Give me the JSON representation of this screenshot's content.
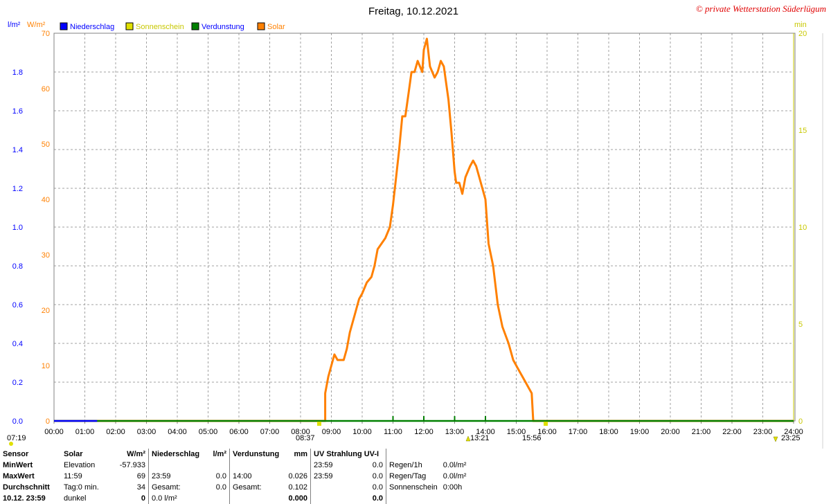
{
  "title": "Freitag, 10.12.2021",
  "copyright": "© private Wetterstation Süderlügum",
  "axis_units": {
    "left_rain": "l/m²",
    "left_solar": "W/m²",
    "right": "min"
  },
  "legend": [
    {
      "label": "Niederschlag",
      "color": "#0000ff",
      "text_color": "#0000ff"
    },
    {
      "label": "Sonnenschein",
      "color": "#e0e000",
      "text_color": "#c8c800"
    },
    {
      "label": "Verdunstung",
      "color": "#008000",
      "text_color": "#0000ff"
    },
    {
      "label": "Solar",
      "color": "#ff8000",
      "text_color": "#ff8000"
    }
  ],
  "markers": {
    "left": "07:19",
    "sunrise": "08:37",
    "noon": "13:21",
    "sunset": "15:56",
    "right": "23:25"
  },
  "right_edge_char": "9",
  "chart_data": {
    "type": "line",
    "title": "Freitag, 10.12.2021",
    "x_ticks": [
      "00:00",
      "01:00",
      "02:00",
      "03:00",
      "04:00",
      "05:00",
      "06:00",
      "07:00",
      "08:00",
      "09:00",
      "10:00",
      "11:00",
      "12:00",
      "13:00",
      "14:00",
      "15:00",
      "16:00",
      "17:00",
      "18:00",
      "19:00",
      "20:00",
      "21:00",
      "22:00",
      "23:00",
      "24:00"
    ],
    "x_range_hours": [
      0,
      24
    ],
    "y_left_rain": {
      "label": "l/m²",
      "range": [
        0,
        2.0
      ],
      "ticks": [
        "0.0",
        "0.2",
        "0.4",
        "0.6",
        "0.8",
        "1.0",
        "1.2",
        "1.4",
        "1.6",
        "1.8"
      ]
    },
    "y_left_solar": {
      "label": "W/m²",
      "range": [
        0,
        70
      ],
      "ticks": [
        "0",
        "10",
        "20",
        "30",
        "40",
        "50",
        "60",
        "70"
      ]
    },
    "y_right": {
      "label": "min",
      "range": [
        0,
        20
      ],
      "ticks": [
        "0",
        "5",
        "10",
        "15",
        "20"
      ]
    },
    "grid": true,
    "series": [
      {
        "name": "Solar",
        "axis": "solar",
        "color": "#ff8000",
        "points": [
          [
            0,
            0
          ],
          [
            8.8,
            0
          ],
          [
            8.8,
            5
          ],
          [
            8.9,
            8
          ],
          [
            9.0,
            10
          ],
          [
            9.1,
            12
          ],
          [
            9.2,
            11
          ],
          [
            9.4,
            11
          ],
          [
            9.5,
            13
          ],
          [
            9.6,
            16
          ],
          [
            9.75,
            19
          ],
          [
            9.9,
            22
          ],
          [
            10.0,
            23
          ],
          [
            10.15,
            25
          ],
          [
            10.3,
            26
          ],
          [
            10.4,
            28
          ],
          [
            10.5,
            31
          ],
          [
            10.75,
            33
          ],
          [
            10.9,
            35
          ],
          [
            11.0,
            39
          ],
          [
            11.1,
            44
          ],
          [
            11.2,
            49
          ],
          [
            11.3,
            55
          ],
          [
            11.4,
            55
          ],
          [
            11.5,
            59
          ],
          [
            11.6,
            63
          ],
          [
            11.7,
            63
          ],
          [
            11.8,
            65
          ],
          [
            11.95,
            63
          ],
          [
            12.0,
            67
          ],
          [
            12.1,
            69
          ],
          [
            12.2,
            64
          ],
          [
            12.35,
            62
          ],
          [
            12.45,
            63
          ],
          [
            12.55,
            65
          ],
          [
            12.65,
            64
          ],
          [
            12.8,
            58
          ],
          [
            12.9,
            52
          ],
          [
            13.0,
            45
          ],
          [
            13.05,
            43
          ],
          [
            13.15,
            43
          ],
          [
            13.25,
            41
          ],
          [
            13.35,
            44
          ],
          [
            13.5,
            46
          ],
          [
            13.6,
            47
          ],
          [
            13.7,
            46
          ],
          [
            13.8,
            44
          ],
          [
            14.0,
            40
          ],
          [
            14.1,
            32
          ],
          [
            14.25,
            28
          ],
          [
            14.4,
            21
          ],
          [
            14.55,
            17
          ],
          [
            14.75,
            14
          ],
          [
            14.9,
            11
          ],
          [
            15.0,
            10
          ],
          [
            15.1,
            9
          ],
          [
            15.3,
            7
          ],
          [
            15.4,
            6
          ],
          [
            15.5,
            5
          ],
          [
            15.55,
            0
          ],
          [
            24,
            0
          ]
        ]
      },
      {
        "name": "Verdunstung",
        "axis": "rain",
        "color": "#008000",
        "points": [
          [
            0,
            0
          ],
          [
            24,
            0
          ]
        ],
        "spikes_hours": [
          11.0,
          12.0,
          13.0,
          14.0
        ]
      },
      {
        "name": "Niederschlag",
        "axis": "rain",
        "color": "#0000ff",
        "points": [
          [
            0,
            0
          ],
          [
            1.4,
            0
          ]
        ]
      }
    ]
  },
  "table": {
    "headers": {
      "sensor": "Sensor",
      "solar": "Solar",
      "solar_unit": "W/m²",
      "rain": "Niederschlag",
      "rain_unit": "l/m²",
      "evap": "Verdunstung",
      "evap_unit": "mm",
      "uv": "UV Strahlung UV-I"
    },
    "rows": [
      {
        "label": "MinWert",
        "s1": "Elevation",
        "s2": "-57.933",
        "r1": "",
        "r2": "",
        "e1": "",
        "e2": "",
        "u1": "23:59",
        "u2": "0.0",
        "x": "Regen/1h",
        "xv": "0.0l/m²"
      },
      {
        "label": "MaxWert",
        "s1": "11:59",
        "s2": "69",
        "r1": "23:59",
        "r2": "0.0",
        "e1": "14:00",
        "e2": "0.026",
        "u1": "23:59",
        "u2": "0.0",
        "x": "Regen/Tag",
        "xv": "0.0l/m²"
      },
      {
        "label": "Durchschnitt",
        "s1": "Tag:0 min.",
        "s2": "34",
        "r1": "Gesamt:",
        "r2": "0.0",
        "e1": "Gesamt:",
        "e2": "0.102",
        "u1": "",
        "u2": "0.0",
        "x": "Sonnenschein",
        "xv": "0:00h"
      },
      {
        "label": "10.12. 23:59",
        "s1": "dunkel",
        "s2": "0",
        "r1": "0.0 l/m²",
        "r2": "",
        "e1": "",
        "e2": "0.000",
        "u1": "",
        "u2": "0.0",
        "x": "",
        "xv": ""
      }
    ]
  }
}
